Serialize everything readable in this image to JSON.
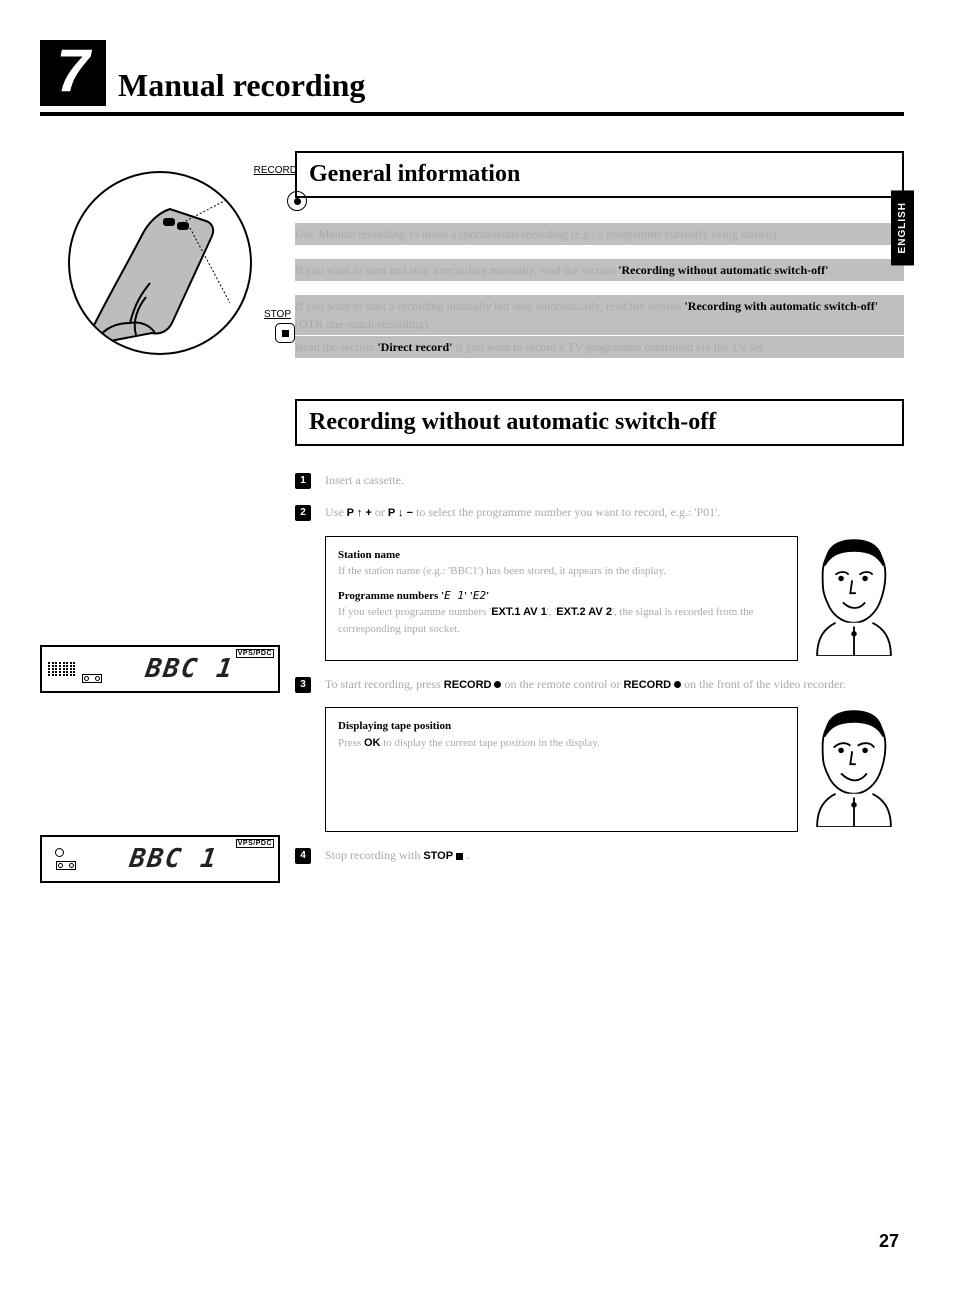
{
  "chapter": {
    "number": "7",
    "title": "Manual recording"
  },
  "language_tab": "ENGLISH",
  "page_number": "27",
  "illustration": {
    "record_label": "RECORD",
    "stop_label": "STOP"
  },
  "display1": {
    "vps": "VPS/PDC",
    "text": "BBC 1"
  },
  "display2": {
    "vps": "VPS/PDC",
    "text": "BBC 1"
  },
  "section_general": {
    "heading": "General information",
    "para1_pre": "Use 'Manual recording' to make a spontaneous recording (e.g.: a programme currently being shown).",
    "para2_pre": "If you want to start and stop a recording manually, read the section ",
    "para2_bold": "'Recording without automatic switch-off'",
    "para2_post": ".",
    "para3_pre": "If you want to start a recording manually but stop automatically, read the section ",
    "para3_bold": "'Recording with automatic switch-off'",
    "para3_post": " (OTR one-touch-recording).",
    "para4_pre": "Read the section ",
    "para4_bold": "'Direct record'",
    "para4_post": " if you want to record a TV programme controlled via the TV set."
  },
  "section_rec": {
    "heading": "Recording without automatic switch-off",
    "step1": "Insert a cassette.",
    "step2_pre": "Use ",
    "step2_k1": "P ↑ +",
    "step2_mid": " or ",
    "step2_k2": "P ↓ −",
    "step2_post": " to select the programme number you want to record, e.g.: 'P01'.",
    "tip1": {
      "h1": "Station name",
      "l1": "If the station name (e.g.: 'BBC1') has been stored, it appears in the display.",
      "h2_pre": "Programme numbers '",
      "h2_seg1": "E 1",
      "h2_mid": "' '",
      "h2_seg2": "E2",
      "h2_post": "'",
      "l2_pre": "If you select programme numbers '",
      "l2_k1": "EXT.1 AV 1",
      "l2_mid": "', '",
      "l2_k2": "EXT.2 AV 2",
      "l2_post": "', the signal is recorded from the corresponding input socket."
    },
    "step3_pre": "To start recording, press ",
    "step3_k1": "RECORD",
    "step3_mid": " on the remote control or ",
    "step3_k2": "RECORD",
    "step3_post": " on the front of the video recorder.",
    "tip2": {
      "h": "Displaying tape position",
      "l_pre": "Press ",
      "l_k": "OK",
      "l_post": " to display the current tape position in the display."
    },
    "step4_pre": "Stop recording with ",
    "step4_k": "STOP",
    "step4_post": " ."
  }
}
